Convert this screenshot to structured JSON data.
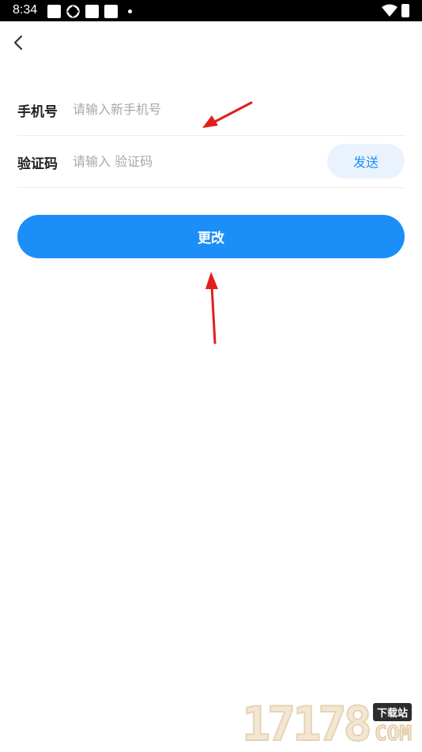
{
  "status_bar": {
    "time": "8:34"
  },
  "form": {
    "phone": {
      "label": "手机号",
      "placeholder": "请输入新手机号",
      "value": ""
    },
    "code": {
      "label": "验证码",
      "placeholder": "请输入 验证码",
      "value": "",
      "send_label": "发送"
    }
  },
  "submit_label": "更改",
  "colors": {
    "primary": "#1b8ff7",
    "send_bg": "#eaf3fd",
    "arrow": "#e0201c"
  },
  "watermark": {
    "digits": "17178",
    "badge": "下载站",
    "domain": "COM"
  }
}
